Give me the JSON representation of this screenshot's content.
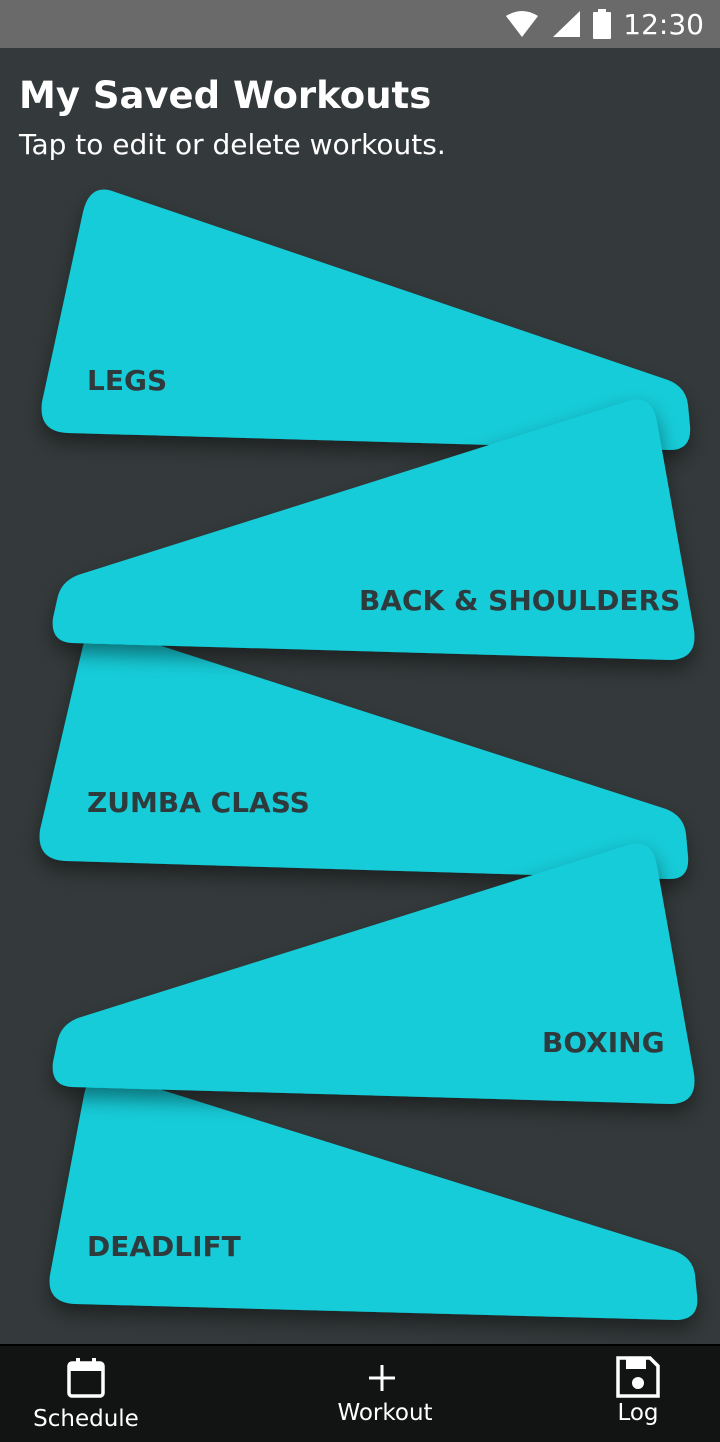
{
  "status_bar": {
    "time": "12:30",
    "icons": [
      "wifi-icon",
      "signal-icon",
      "battery-icon"
    ]
  },
  "header": {
    "title": "My Saved Workouts",
    "subtitle": "Tap to edit or delete workouts."
  },
  "workouts": [
    {
      "label": "LEGS"
    },
    {
      "label": "BACK & SHOULDERS"
    },
    {
      "label": "ZUMBA CLASS"
    },
    {
      "label": "BOXING"
    },
    {
      "label": "DEADLIFT"
    }
  ],
  "bottom_nav": {
    "schedule": {
      "label": "Schedule",
      "icon": "calendar-icon"
    },
    "workout": {
      "label": "Workout",
      "icon": "plus-icon"
    },
    "log": {
      "label": "Log",
      "icon": "save-icon"
    }
  },
  "colors": {
    "card": "#13ccd8",
    "background": "#343a3b",
    "nav": "#121414",
    "label": "#2f3a3c"
  }
}
